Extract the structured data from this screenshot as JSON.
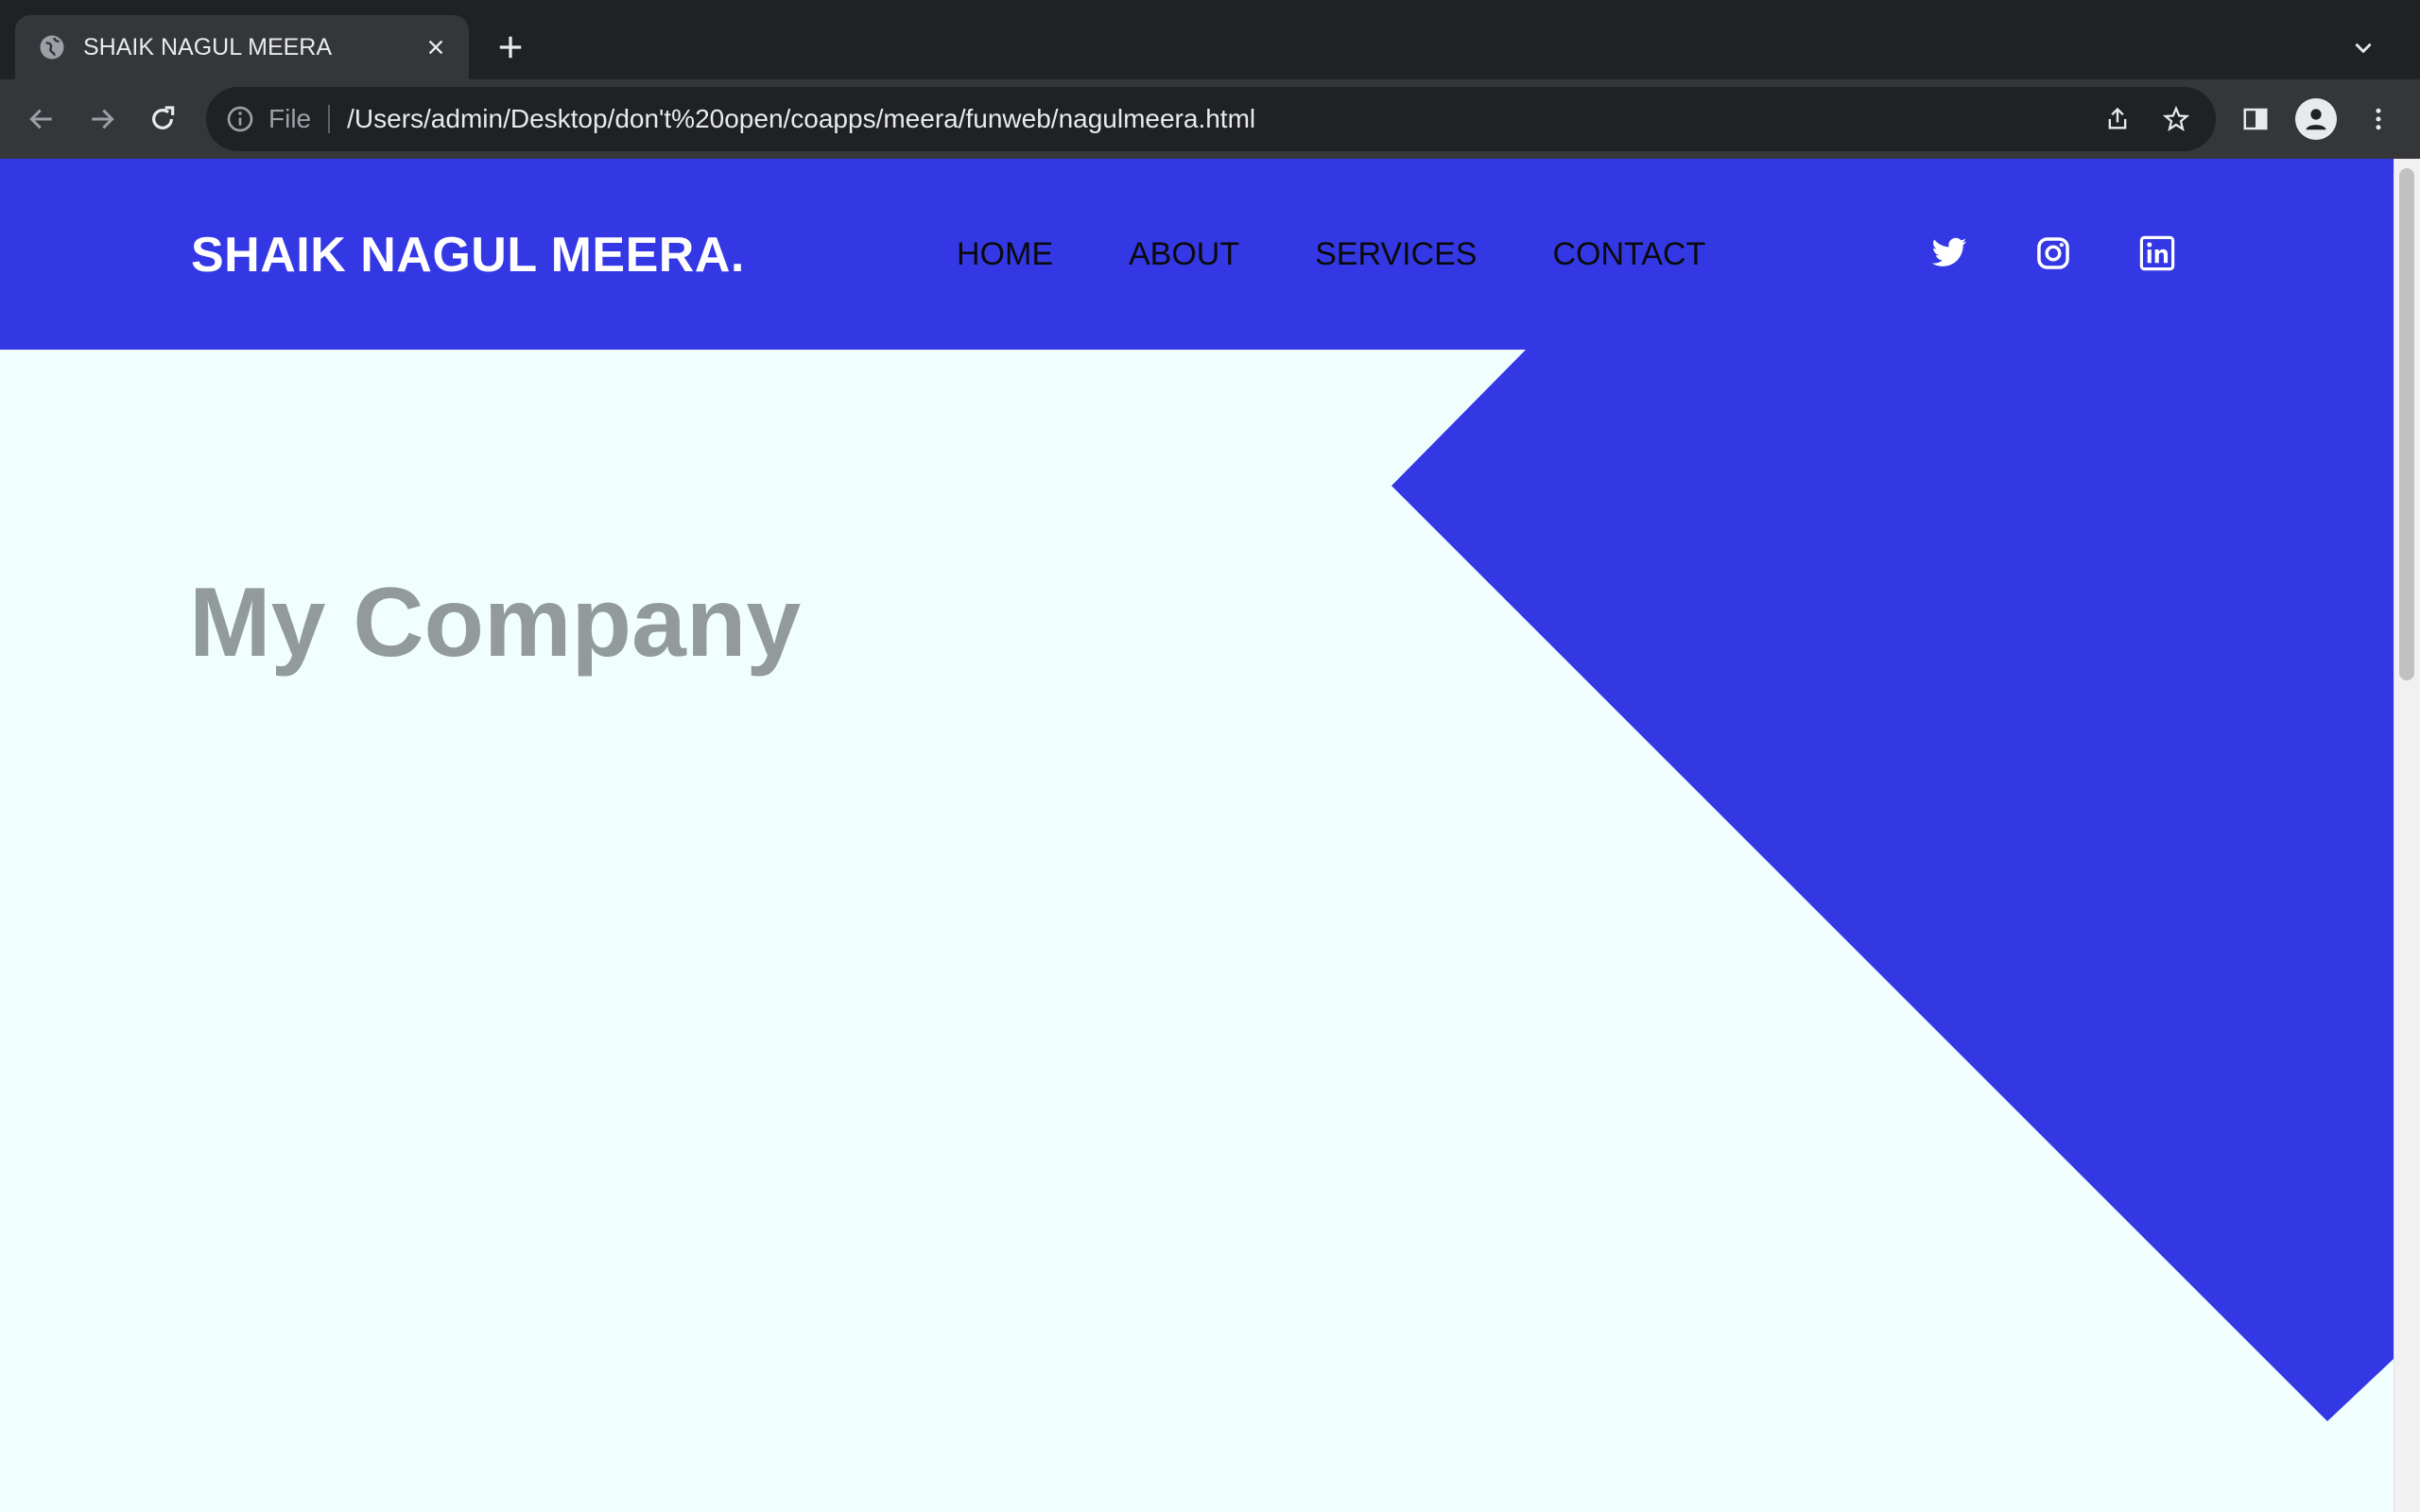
{
  "browser": {
    "tab": {
      "title": "SHAIK NAGUL MEERA"
    },
    "address_bar": {
      "scheme_label": "File",
      "url": "/Users/admin/Desktop/don't%20open/coapps/meera/funweb/nagulmeera.html"
    }
  },
  "site": {
    "brand": "SHAIK NAGUL MEERA.",
    "nav": [
      "HOME",
      "ABOUT",
      "SERVICES",
      "CONTACT"
    ],
    "socials": [
      "twitter-icon",
      "instagram-icon",
      "linkedin-icon"
    ],
    "hero": {
      "title": "My Company"
    }
  },
  "colors": {
    "accent": "#3438e4",
    "page_background": "#f0fffe",
    "hero_text": "#929b9a",
    "chrome_dark": "#202124",
    "chrome_toolbar": "#35363a"
  }
}
